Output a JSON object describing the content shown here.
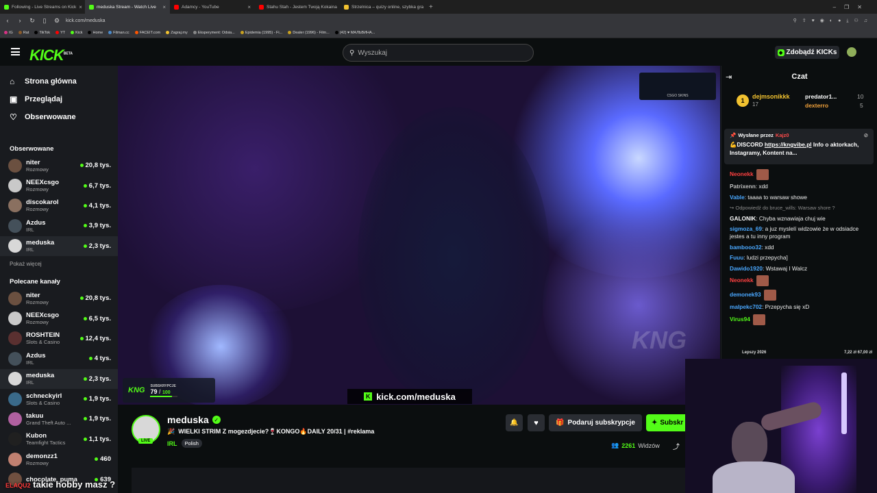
{
  "browser": {
    "tabs": [
      {
        "title": "Following - Live Streams on Kick",
        "color": "#53fc18",
        "active": false
      },
      {
        "title": "meduska Stream - Watch Live",
        "color": "#53fc18",
        "active": true
      },
      {
        "title": "Adamcy - YouTube",
        "color": "#ff0000",
        "active": false
      },
      {
        "title": "Stahu Stah - Jestem Twoją Kokaina",
        "color": "#ff0000",
        "active": false
      },
      {
        "title": "Strzelnica – quizy online, szybka gra",
        "color": "#f2c230",
        "active": false
      }
    ],
    "new_tab": "+",
    "url": "kick.com/meduska",
    "bookmarks": [
      "IG",
      "Rat",
      "TikTok",
      "YT",
      "Kick",
      "Home",
      "Filman.cc",
      "FACEIT.com",
      "Zagraj.my",
      "Eksperyment: Odsia...",
      "Epidemia (1995) - Fi...",
      "Dealer (1996) - Film...",
      "(42) ♥ МАЛЬВИНА..."
    ]
  },
  "header": {
    "logo": "KICK",
    "beta": "BETA",
    "search_placeholder": "Wyszukaj",
    "get_kicks": "Zdobądź KICKs"
  },
  "sidebar": {
    "nav": [
      {
        "label": "Strona główna",
        "icon": "home-icon"
      },
      {
        "label": "Przeglądaj",
        "icon": "browse-icon"
      },
      {
        "label": "Obserwowane",
        "icon": "heart-icon"
      }
    ],
    "followed_title": "Obserwowane",
    "followed": [
      {
        "name": "niter",
        "category": "Rozmowy",
        "viewers": "20,8 tys.",
        "color": "#6b5040"
      },
      {
        "name": "NEEXcsgo",
        "category": "Rozmowy",
        "viewers": "6,7 tys.",
        "color": "#c9c9c9"
      },
      {
        "name": "discokarol",
        "category": "Rozmowy",
        "viewers": "4,1 tys.",
        "color": "#8a7060"
      },
      {
        "name": "Azdus",
        "category": "IRL",
        "viewers": "3,9 tys.",
        "color": "#44505a"
      },
      {
        "name": "meduska",
        "category": "IRL",
        "viewers": "2,3 tys.",
        "color": "#d8d8d8",
        "selected": true
      }
    ],
    "show_more": "Pokaż więcej",
    "recommended_title": "Polecane kanały",
    "recommended": [
      {
        "name": "niter",
        "category": "Rozmowy",
        "viewers": "20,8 tys.",
        "color": "#6b5040"
      },
      {
        "name": "NEEXcsgo",
        "category": "Rozmowy",
        "viewers": "6,5 tys.",
        "color": "#c9c9c9"
      },
      {
        "name": "ROSHTEIN",
        "category": "Slots & Casino",
        "viewers": "12,4 tys.",
        "color": "#5a3030"
      },
      {
        "name": "Azdus",
        "category": "IRL",
        "viewers": "4 tys.",
        "color": "#44505a"
      },
      {
        "name": "meduska",
        "category": "IRL",
        "viewers": "2,3 tys.",
        "color": "#d8d8d8",
        "selected": true
      },
      {
        "name": "schneckyirl",
        "category": "Slots & Casino",
        "viewers": "1,9 tys.",
        "color": "#3a6a8a"
      },
      {
        "name": "takuu",
        "category": "Grand Theft Auto ...",
        "viewers": "1,9 tys.",
        "color": "#b060a0"
      },
      {
        "name": "Kubon",
        "category": "Teamfight Tactics",
        "viewers": "1,1 tys.",
        "color": "#202020"
      },
      {
        "name": "demonzz1",
        "category": "Rozmowy",
        "viewers": "460",
        "color": "#c08070"
      },
      {
        "name": "chocolate_puma",
        "category": "",
        "viewers": "639",
        "color": "#705040"
      }
    ]
  },
  "video": {
    "overlay_url": "kick.com/meduska",
    "sub_label": "SUBSKRYPCJE",
    "sub_count": "79",
    "sub_goal": "100",
    "sub_progress": 0.79,
    "sponsor": "CSGO SKINS",
    "watermark": "KNG"
  },
  "stream": {
    "name": "meduska",
    "live": "LIVE",
    "title": "WIELKI STRIM Z mogezdjecie?🍷KONGO🔥DAILY 20/31 | #reklama",
    "category": "IRL",
    "tag": "Polish",
    "viewers": "2261",
    "viewers_label": "Widzów",
    "gift_sub": "Podaruj subskrypcje",
    "subscribe": "Subskr",
    "caption": "takie hobby masz ?"
  },
  "chat": {
    "title": "Czat",
    "leaders": [
      {
        "rank": "1",
        "name": "dejmsonikkk",
        "count": "17",
        "color": "#f2c230"
      },
      {
        "name": "predator1...",
        "count": "10",
        "color": "#fff"
      },
      {
        "name": "dexterro",
        "count": "5",
        "color": "#f2a23a"
      }
    ],
    "pinned_by": "Wysłane przez",
    "pinned_user": "Kajz0",
    "pinned_text": "💪DISCORD",
    "pinned_link": "https://kngvibe.pl",
    "pinned_rest": "Info o aktorkach, Instagramy, Kontent na...",
    "messages": [
      {
        "user": "Neonekk",
        "color": "#ff4040",
        "text": ""
      },
      {
        "user": "Patrixenn",
        "color": "#c0c0c0",
        "text": ": xdd"
      },
      {
        "user": "Vable",
        "color": "#4aa8ff",
        "text": ": taaaa to warsaw showe"
      },
      {
        "reply": "↪ Odpowiedź do bruce_wills: Warsaw shore ?"
      },
      {
        "user": "GALONIK",
        "color": "#ffffff",
        "text": ": Chyba wznawiaja chuj wie"
      },
      {
        "user": "sigmoza_69",
        "color": "#4aa8ff",
        "text": ": a juz myslelí widzowie że w odsiadce jestes a tu inny program"
      },
      {
        "user": "bambooo32",
        "color": "#4aa8ff",
        "text": ": xdd"
      },
      {
        "user": "Fuuu",
        "color": "#4aa8ff",
        "text": ": ludzi przepycha]"
      },
      {
        "user": "Dawido1920",
        "color": "#4aa8ff",
        "text": ": Wstawaj I Walcz"
      },
      {
        "user": "Neonekk",
        "color": "#ff4040",
        "text": ""
      },
      {
        "user": "demonek93",
        "color": "#4aa8ff",
        "text": ""
      },
      {
        "user": "malpekc702",
        "color": "#4aa8ff",
        "text": ": Przepycha się xD"
      },
      {
        "user": "Virus94",
        "color": "#53fc18",
        "text": ""
      }
    ],
    "ticker_label": "Lepszy 2026",
    "ticker_left": "7,22 zł",
    "ticker_right": "67,00 zł"
  }
}
